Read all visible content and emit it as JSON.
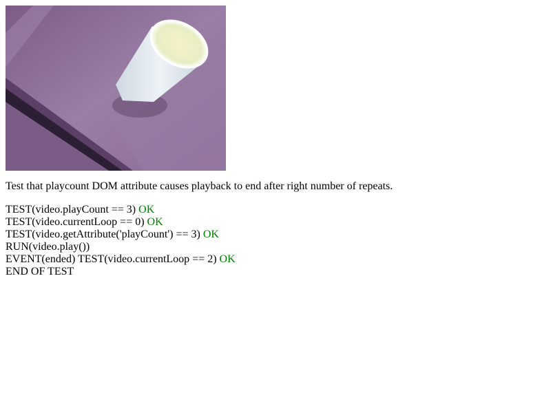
{
  "description": "Test that playcount DOM attribute causes playback to end after right number of repeats.",
  "colors": {
    "ok": "#008000",
    "text": "#000000",
    "background": "#ffffff"
  },
  "log": [
    {
      "text": "TEST(video.playCount == 3) ",
      "status": "OK"
    },
    {
      "text": "TEST(video.currentLoop == 0) ",
      "status": "OK"
    },
    {
      "text": "TEST(video.getAttribute('playCount') == 3) ",
      "status": "OK"
    },
    {
      "text": "RUN(video.play())",
      "status": ""
    },
    {
      "text": "EVENT(ended) TEST(video.currentLoop == 2) ",
      "status": "OK"
    },
    {
      "text": "END OF TEST",
      "status": ""
    }
  ]
}
